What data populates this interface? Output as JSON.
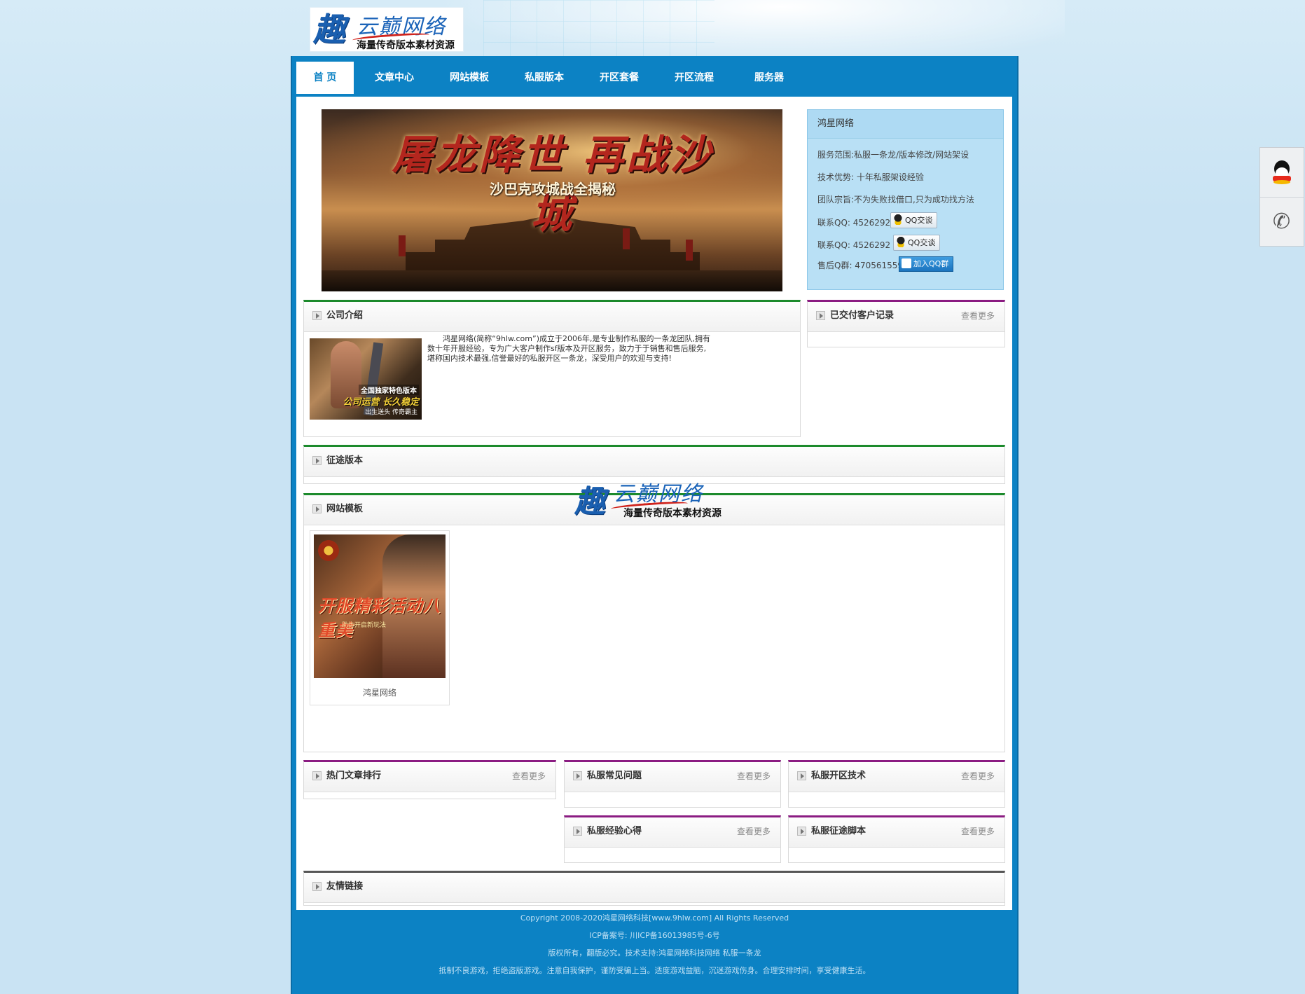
{
  "logo": {
    "glyph": "趣",
    "name": "云巅网络",
    "tagline": "海量传奇版本素材资源"
  },
  "nav": [
    {
      "label": "首 页",
      "active": true
    },
    {
      "label": "文章中心"
    },
    {
      "label": "网站模板"
    },
    {
      "label": "私服版本"
    },
    {
      "label": "开区套餐"
    },
    {
      "label": "开区流程"
    },
    {
      "label": "服务器"
    }
  ],
  "banner": {
    "title": "屠龙降世 再战沙城",
    "subtitle": "沙巴克攻城战全揭秘"
  },
  "info": {
    "title": "鸿星网络",
    "lines": [
      "服务范围:私服一条龙/版本修改/网站架设",
      "技术优势: 十年私服架设经验",
      "团队宗旨:不为失败找借口,只为成功找方法",
      "联系QQ: 4526292",
      "联系QQ: 4526292",
      "售后Q群: 470561559"
    ],
    "qq_btn": "QQ交谈",
    "qq_group_btn": "加入QQ群"
  },
  "panels": {
    "intro": {
      "title": "公司介绍",
      "text": "鸿星网络(简称“9hlw.com”)成立于2006年,是专业制作私服的一条龙团队,拥有数十年开服经验，专为广大客户制作sf版本及开区服务，致力于于销售和售后服务,堪称国内技术最强,信誉最好的私服开区一条龙，深受用户的欢迎与支持!",
      "image_caption_1": "全国独家特色版本",
      "image_caption_2": "公司运营 长久稳定",
      "image_caption_3": "出生送头 传奇霸主"
    },
    "delivered": {
      "title": "已交付客户记录",
      "more": "查看更多"
    },
    "zhengtu": {
      "title": "征途版本"
    },
    "templates": {
      "title": "网站模板",
      "items": [
        {
          "caption": "鸿星网络",
          "img_text": "开服精彩活动八重美",
          "img_small": "助你开启新玩法"
        }
      ]
    },
    "hot": {
      "title": "热门文章排行",
      "more": "查看更多"
    },
    "faq": {
      "title": "私服常见问题",
      "more": "查看更多"
    },
    "tech": {
      "title": "私服开区技术",
      "more": "查看更多"
    },
    "exp": {
      "title": "私服经验心得",
      "more": "查看更多"
    },
    "script": {
      "title": "私服征途脚本",
      "more": "查看更多"
    },
    "links": {
      "title": "友情链接"
    }
  },
  "watermark": {
    "glyph": "趣",
    "name": "云巅网络",
    "tagline": "海量传奇版本素材资源"
  },
  "footer": [
    "Copyright 2008-2020鸿星网络科技[www.9hlw.com] All Rights Reserved",
    "ICP备案号: 川ICP备16013985号-6号",
    "版权所有，翻版必究。技术支持:鸿星网络科技网络 私服一条龙",
    "抵制不良游戏，拒绝盗版游戏。注意自我保护，谨防受骗上当。适度游戏益脑，沉迷游戏伤身。合理安排时间，享受健康生活。"
  ],
  "side": {
    "qq_icon": "qq-penguin-icon",
    "phone_icon": "phone-icon"
  },
  "colors": {
    "frame": "#0c82c4",
    "green_rule": "#1c8a2c",
    "purple_rule": "#8b1c82",
    "info_bg": "#b9e0f5"
  }
}
